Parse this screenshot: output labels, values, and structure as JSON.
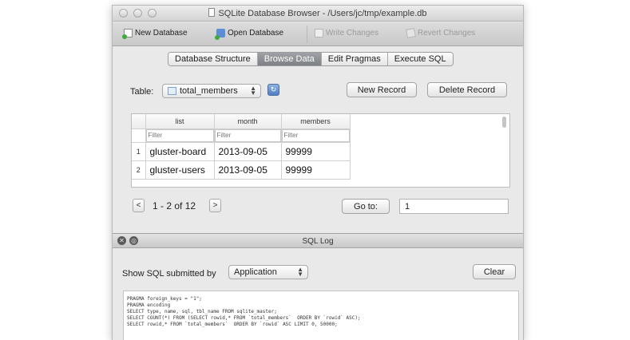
{
  "window": {
    "title": "SQLite Database Browser - /Users/jc/tmp/example.db"
  },
  "toolbar": {
    "new_database": "New Database",
    "open_database": "Open Database",
    "write_changes": "Write Changes",
    "revert_changes": "Revert Changes"
  },
  "tabs": [
    {
      "label": "Database Structure",
      "active": false
    },
    {
      "label": "Browse Data",
      "active": true
    },
    {
      "label": "Edit Pragmas",
      "active": false
    },
    {
      "label": "Execute SQL",
      "active": false
    }
  ],
  "browse": {
    "table_label": "Table:",
    "table_value": "total_members",
    "new_record": "New Record",
    "delete_record": "Delete Record",
    "columns": [
      "list",
      "month",
      "members"
    ],
    "filter_placeholder": "Filter",
    "rows": [
      {
        "num": "1",
        "cells": [
          "gluster-board",
          "2013-09-05",
          "99999"
        ]
      },
      {
        "num": "2",
        "cells": [
          "gluster-users",
          "2013-09-05",
          "99999"
        ]
      }
    ],
    "prev": "<",
    "next": ">",
    "page_info": "1 - 2 of 12",
    "goto_label": "Go to:",
    "goto_value": "1"
  },
  "sql_log": {
    "title": "SQL Log",
    "show_label": "Show SQL submitted by",
    "source_value": "Application",
    "clear": "Clear",
    "lines": [
      "PRAGMA foreign_keys = \"1\";",
      "PRAGMA encoding",
      "SELECT type, name, sql, tbl_name FROM sqlite_master;",
      "SELECT COUNT(*) FROM (SELECT rowid,* FROM `total_members`  ORDER BY `rowid` ASC);",
      "SELECT rowid,* FROM `total_members`  ORDER BY `rowid` ASC LIMIT 0, 50000;"
    ]
  }
}
